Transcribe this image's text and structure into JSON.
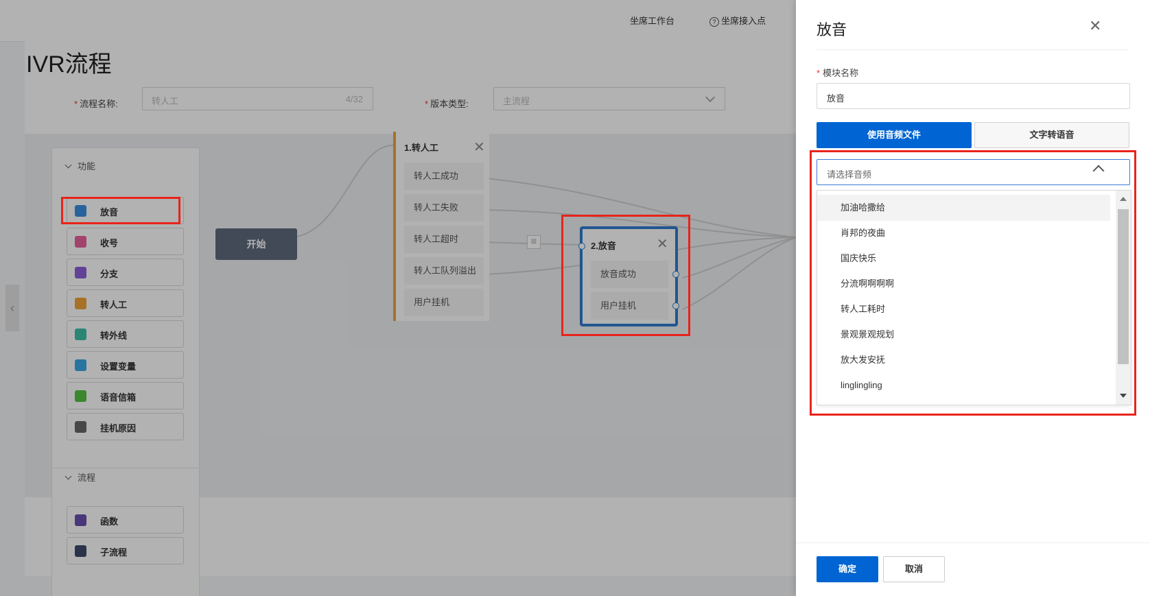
{
  "topbar": {
    "workbench": "坐席工作台",
    "access_point": "坐席接入点"
  },
  "page": {
    "title": "IVR流程"
  },
  "form": {
    "flow_name_label": "流程名称:",
    "flow_name_placeholder": "转人工",
    "flow_name_count": "4/32",
    "version_label": "版本类型:",
    "version_placeholder": "主流程"
  },
  "palette": {
    "section_function": "功能",
    "function_items": [
      {
        "label": "放音",
        "icon": "audio-wave-icon",
        "color": "#3b8fe0"
      },
      {
        "label": "收号",
        "icon": "receive-digits-icon",
        "color": "#e8609a"
      },
      {
        "label": "分支",
        "icon": "branch-icon",
        "color": "#8c5fd8"
      },
      {
        "label": "转人工",
        "icon": "agent-icon",
        "color": "#f0a23a"
      },
      {
        "label": "转外线",
        "icon": "outside-line-icon",
        "color": "#3dbfa5"
      },
      {
        "label": "设置变量",
        "icon": "variable-icon",
        "color": "#3aa6e6"
      },
      {
        "label": "语音信箱",
        "icon": "voicemail-icon",
        "color": "#53c243"
      },
      {
        "label": "挂机原因",
        "icon": "hangup-icon",
        "color": "#666666"
      }
    ],
    "section_flow": "流程",
    "flow_items": [
      {
        "label": "函数",
        "icon": "function-sigma-icon",
        "color": "#6a4fb0"
      },
      {
        "label": "子流程",
        "icon": "subflow-icon",
        "color": "#3d4a6b"
      }
    ]
  },
  "canvas": {
    "start_label": "开始",
    "node1": {
      "title": "1.转人工",
      "rows": [
        "转人工成功",
        "转人工失败",
        "转人工超时",
        "转人工队列溢出",
        "用户挂机"
      ]
    },
    "node2": {
      "title": "2.放音",
      "rows": [
        "放音成功",
        "用户挂机"
      ]
    }
  },
  "drawer": {
    "title": "放音",
    "field_label": "模块名称",
    "name_value": "放音",
    "tab_audio": "使用音频文件",
    "tab_tts": "文字转语音",
    "select_placeholder": "请选择音频",
    "options": [
      "加油哈撒给",
      "肖邦的夜曲",
      "国庆快乐",
      "分流啊啊啊啊",
      "转人工耗时",
      "景观景观规划",
      "放大发安抚",
      "linglingling"
    ],
    "ok_label": "确定",
    "cancel_label": "取消"
  },
  "colors": {
    "primary": "#0064d2",
    "highlight_box": "#e8231a",
    "node1_accent": "#f0a23a",
    "node2_accent": "#2f7bd0"
  }
}
